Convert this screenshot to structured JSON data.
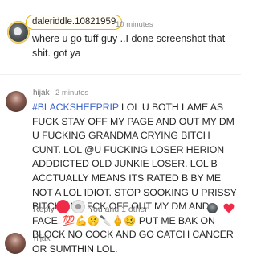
{
  "comment1": {
    "username": "daleriddle.10821959",
    "time": "10 minutes",
    "text": "where u go tuff guy ..I done screenshot that shit. got ya"
  },
  "comment2": {
    "username": "hijak",
    "time": "2 minutes",
    "hashtag": "#BLACKSHEEPRIP",
    "text": " LOL U BOTH LAME AS FUCK STAY OFF MY PAGE AND OUT MY DM U FUCKING GRANDMA CRYING BITCH CUNT. LOL @U FUCKING LOSER HERION ADDDICTED OLD JUNKIE LOSER. LOL B ACCTUALLY MEANS ITS RATED B BY ME NOT A LOL IDIOT. STOP SOOKING U PRISSY BITCH AND FCK OFF OUT MY DM AND FACE. 💯💪🤫🔪🖕🥴 PUT ME BAK ON BLOCK NO COCK AND GO CATCH CANCER OR SUMTHIN LOL.",
    "reply_label": "Reply",
    "reactions_label": "You and 1 other"
  },
  "comment3": {
    "username": "hijak"
  },
  "colors": {
    "hashtag": "#3a62c9",
    "badge_border": "#f0b400",
    "like_heart": "#ef2b4a"
  }
}
